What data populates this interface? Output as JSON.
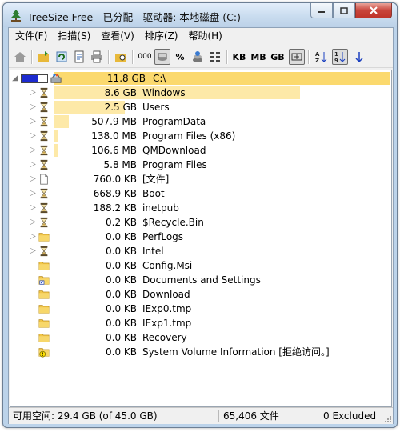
{
  "window": {
    "title": "TreeSize Free - 已分配 - 驱动器: 本地磁盘 (C:)"
  },
  "menu": [
    "文件(F)",
    "扫描(S)",
    "查看(V)",
    "排序(Z)",
    "帮助(H)"
  ],
  "toolbar": {
    "unit_kb": "KB",
    "unit_mb": "MB",
    "unit_gb": "GB",
    "count_label": "000",
    "percent_label": "%"
  },
  "tree": {
    "root": {
      "size": "11.8 GB",
      "name": "C:\\",
      "percent_fill": 0.65,
      "bar_fraction": 1.0
    },
    "items": [
      {
        "size": "8.6 GB",
        "name": "Windows",
        "icon": "hourglass-icon",
        "expandable": true,
        "bar_fraction": 0.73
      },
      {
        "size": "2.5 GB",
        "name": "Users",
        "icon": "hourglass-icon",
        "expandable": true,
        "bar_fraction": 0.21
      },
      {
        "size": "507.9 MB",
        "name": "ProgramData",
        "icon": "hourglass-icon",
        "expandable": true,
        "bar_fraction": 0.042
      },
      {
        "size": "138.0 MB",
        "name": "Program Files (x86)",
        "icon": "hourglass-icon",
        "expandable": true,
        "bar_fraction": 0.012
      },
      {
        "size": "106.6 MB",
        "name": "QMDownload",
        "icon": "hourglass-icon",
        "expandable": true,
        "bar_fraction": 0.009
      },
      {
        "size": "5.8 MB",
        "name": "Program Files",
        "icon": "hourglass-icon",
        "expandable": true,
        "bar_fraction": 0.0
      },
      {
        "size": "760.0 KB",
        "name": "[文件]",
        "icon": "file-icon",
        "expandable": true,
        "bar_fraction": 0.0
      },
      {
        "size": "668.9 KB",
        "name": "Boot",
        "icon": "hourglass-icon",
        "expandable": true,
        "bar_fraction": 0.0
      },
      {
        "size": "188.2 KB",
        "name": "inetpub",
        "icon": "hourglass-icon",
        "expandable": true,
        "bar_fraction": 0.0
      },
      {
        "size": "0.2 KB",
        "name": "$Recycle.Bin",
        "icon": "hourglass-icon",
        "expandable": true,
        "bar_fraction": 0.0
      },
      {
        "size": "0.0 KB",
        "name": "PerfLogs",
        "icon": "folder-icon",
        "expandable": true,
        "bar_fraction": 0.0
      },
      {
        "size": "0.0 KB",
        "name": "Intel",
        "icon": "hourglass-icon",
        "expandable": true,
        "bar_fraction": 0.0
      },
      {
        "size": "0.0 KB",
        "name": "Config.Msi",
        "icon": "folder-icon",
        "expandable": false,
        "bar_fraction": 0.0
      },
      {
        "size": "0.0 KB",
        "name": "Documents and Settings",
        "icon": "shortcut-folder-icon",
        "expandable": false,
        "bar_fraction": 0.0
      },
      {
        "size": "0.0 KB",
        "name": "Download",
        "icon": "folder-icon",
        "expandable": false,
        "bar_fraction": 0.0
      },
      {
        "size": "0.0 KB",
        "name": "IExp0.tmp",
        "icon": "folder-icon",
        "expandable": false,
        "bar_fraction": 0.0
      },
      {
        "size": "0.0 KB",
        "name": "IExp1.tmp",
        "icon": "folder-icon",
        "expandable": false,
        "bar_fraction": 0.0
      },
      {
        "size": "0.0 KB",
        "name": "Recovery",
        "icon": "folder-icon",
        "expandable": false,
        "bar_fraction": 0.0
      },
      {
        "size": "0.0 KB",
        "name": "System Volume Information  [拒绝访问。]",
        "icon": "warning-folder-icon",
        "expandable": false,
        "bar_fraction": 0.0
      }
    ]
  },
  "status": {
    "free_space": "可用空间: 29.4 GB  (of 45.0 GB)",
    "file_count": "65,406  文件",
    "excluded": "0 Excluded"
  },
  "colors": {
    "size_bar": "#fde9a8",
    "root_bar": "#fbd96e",
    "percent_fill": "#1d2bd0",
    "window_frame": "#bcd3ea"
  }
}
